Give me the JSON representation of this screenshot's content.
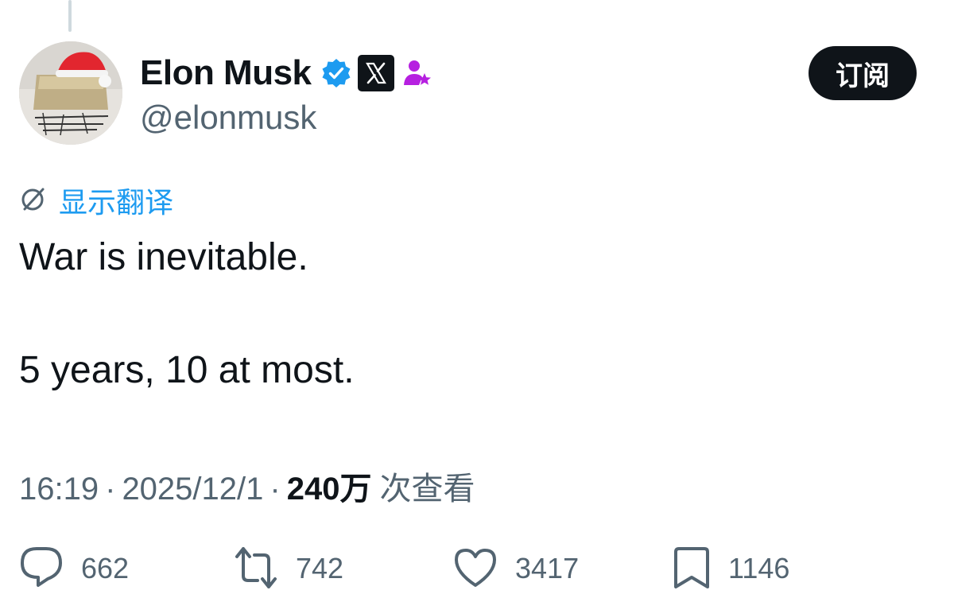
{
  "tweet": {
    "author": {
      "display_name": "Elon Musk",
      "handle": "@elonmusk",
      "avatar_icon": "avatar-image",
      "badges": [
        "verified-badge-icon",
        "x-affiliate-icon",
        "subscriber-star-icon"
      ]
    },
    "subscribe_label": "订阅",
    "translate_label": "显示翻译",
    "text_lines": [
      "War is inevitable.",
      "5 years, 10 at most."
    ],
    "meta": {
      "time": "16:19",
      "separator": "·",
      "date": "2025/12/1",
      "views_count": "240万",
      "views_label": "次查看"
    },
    "actions": {
      "replies": "662",
      "reposts": "742",
      "likes": "3417",
      "bookmarks": "1146"
    }
  },
  "colors": {
    "accent": "#1d9bf0",
    "text": "#0f1419",
    "muted": "#536471",
    "subscriber_badge": "#b620e0"
  }
}
